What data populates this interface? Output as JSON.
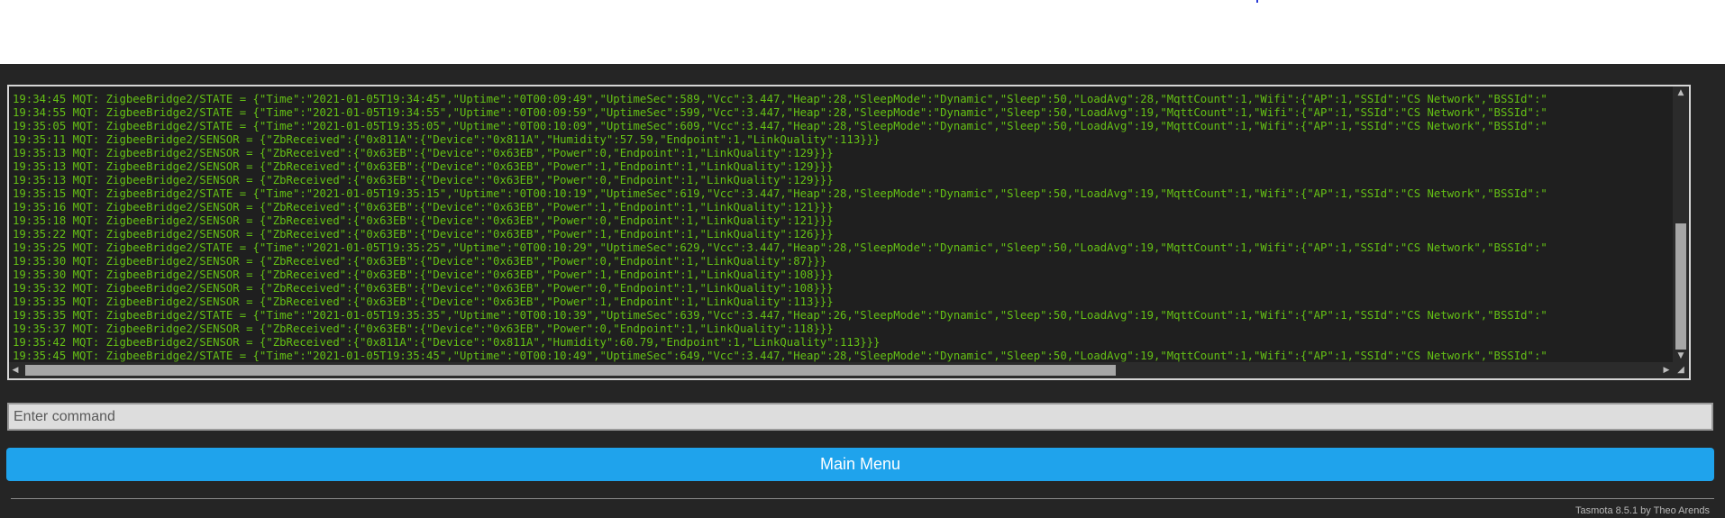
{
  "console": {
    "lines": [
      "19:34:45 MQT: ZigbeeBridge2/STATE = {\"Time\":\"2021-01-05T19:34:45\",\"Uptime\":\"0T00:09:49\",\"UptimeSec\":589,\"Vcc\":3.447,\"Heap\":28,\"SleepMode\":\"Dynamic\",\"Sleep\":50,\"LoadAvg\":28,\"MqttCount\":1,\"Wifi\":{\"AP\":1,\"SSId\":\"CS Network\",\"BSSId\":\"",
      "19:34:55 MQT: ZigbeeBridge2/STATE = {\"Time\":\"2021-01-05T19:34:55\",\"Uptime\":\"0T00:09:59\",\"UptimeSec\":599,\"Vcc\":3.447,\"Heap\":28,\"SleepMode\":\"Dynamic\",\"Sleep\":50,\"LoadAvg\":19,\"MqttCount\":1,\"Wifi\":{\"AP\":1,\"SSId\":\"CS Network\",\"BSSId\":\"",
      "19:35:05 MQT: ZigbeeBridge2/STATE = {\"Time\":\"2021-01-05T19:35:05\",\"Uptime\":\"0T00:10:09\",\"UptimeSec\":609,\"Vcc\":3.447,\"Heap\":28,\"SleepMode\":\"Dynamic\",\"Sleep\":50,\"LoadAvg\":19,\"MqttCount\":1,\"Wifi\":{\"AP\":1,\"SSId\":\"CS Network\",\"BSSId\":\"",
      "19:35:11 MQT: ZigbeeBridge2/SENSOR = {\"ZbReceived\":{\"0x811A\":{\"Device\":\"0x811A\",\"Humidity\":57.59,\"Endpoint\":1,\"LinkQuality\":113}}}",
      "19:35:13 MQT: ZigbeeBridge2/SENSOR = {\"ZbReceived\":{\"0x63EB\":{\"Device\":\"0x63EB\",\"Power\":0,\"Endpoint\":1,\"LinkQuality\":129}}}",
      "19:35:13 MQT: ZigbeeBridge2/SENSOR = {\"ZbReceived\":{\"0x63EB\":{\"Device\":\"0x63EB\",\"Power\":1,\"Endpoint\":1,\"LinkQuality\":129}}}",
      "19:35:13 MQT: ZigbeeBridge2/SENSOR = {\"ZbReceived\":{\"0x63EB\":{\"Device\":\"0x63EB\",\"Power\":0,\"Endpoint\":1,\"LinkQuality\":129}}}",
      "19:35:15 MQT: ZigbeeBridge2/STATE = {\"Time\":\"2021-01-05T19:35:15\",\"Uptime\":\"0T00:10:19\",\"UptimeSec\":619,\"Vcc\":3.447,\"Heap\":28,\"SleepMode\":\"Dynamic\",\"Sleep\":50,\"LoadAvg\":19,\"MqttCount\":1,\"Wifi\":{\"AP\":1,\"SSId\":\"CS Network\",\"BSSId\":\"",
      "19:35:16 MQT: ZigbeeBridge2/SENSOR = {\"ZbReceived\":{\"0x63EB\":{\"Device\":\"0x63EB\",\"Power\":1,\"Endpoint\":1,\"LinkQuality\":121}}}",
      "19:35:18 MQT: ZigbeeBridge2/SENSOR = {\"ZbReceived\":{\"0x63EB\":{\"Device\":\"0x63EB\",\"Power\":0,\"Endpoint\":1,\"LinkQuality\":121}}}",
      "19:35:22 MQT: ZigbeeBridge2/SENSOR = {\"ZbReceived\":{\"0x63EB\":{\"Device\":\"0x63EB\",\"Power\":1,\"Endpoint\":1,\"LinkQuality\":126}}}",
      "19:35:25 MQT: ZigbeeBridge2/STATE = {\"Time\":\"2021-01-05T19:35:25\",\"Uptime\":\"0T00:10:29\",\"UptimeSec\":629,\"Vcc\":3.447,\"Heap\":28,\"SleepMode\":\"Dynamic\",\"Sleep\":50,\"LoadAvg\":19,\"MqttCount\":1,\"Wifi\":{\"AP\":1,\"SSId\":\"CS Network\",\"BSSId\":\"",
      "19:35:30 MQT: ZigbeeBridge2/SENSOR = {\"ZbReceived\":{\"0x63EB\":{\"Device\":\"0x63EB\",\"Power\":0,\"Endpoint\":1,\"LinkQuality\":87}}}",
      "19:35:30 MQT: ZigbeeBridge2/SENSOR = {\"ZbReceived\":{\"0x63EB\":{\"Device\":\"0x63EB\",\"Power\":1,\"Endpoint\":1,\"LinkQuality\":108}}}",
      "19:35:32 MQT: ZigbeeBridge2/SENSOR = {\"ZbReceived\":{\"0x63EB\":{\"Device\":\"0x63EB\",\"Power\":0,\"Endpoint\":1,\"LinkQuality\":108}}}",
      "19:35:35 MQT: ZigbeeBridge2/SENSOR = {\"ZbReceived\":{\"0x63EB\":{\"Device\":\"0x63EB\",\"Power\":1,\"Endpoint\":1,\"LinkQuality\":113}}}",
      "19:35:35 MQT: ZigbeeBridge2/STATE = {\"Time\":\"2021-01-05T19:35:35\",\"Uptime\":\"0T00:10:39\",\"UptimeSec\":639,\"Vcc\":3.447,\"Heap\":26,\"SleepMode\":\"Dynamic\",\"Sleep\":50,\"LoadAvg\":19,\"MqttCount\":1,\"Wifi\":{\"AP\":1,\"SSId\":\"CS Network\",\"BSSId\":\"",
      "19:35:37 MQT: ZigbeeBridge2/SENSOR = {\"ZbReceived\":{\"0x63EB\":{\"Device\":\"0x63EB\",\"Power\":0,\"Endpoint\":1,\"LinkQuality\":118}}}",
      "19:35:42 MQT: ZigbeeBridge2/SENSOR = {\"ZbReceived\":{\"0x811A\":{\"Device\":\"0x811A\",\"Humidity\":60.79,\"Endpoint\":1,\"LinkQuality\":113}}}",
      "19:35:45 MQT: ZigbeeBridge2/STATE = {\"Time\":\"2021-01-05T19:35:45\",\"Uptime\":\"0T00:10:49\",\"UptimeSec\":649,\"Vcc\":3.447,\"Heap\":28,\"SleepMode\":\"Dynamic\",\"Sleep\":50,\"LoadAvg\":19,\"MqttCount\":1,\"Wifi\":{\"AP\":1,\"SSId\":\"CS Network\",\"BSSId\":\""
    ],
    "text_color": "#65c115",
    "background_color": "#1f1f1f"
  },
  "command": {
    "placeholder": "Enter command",
    "value": ""
  },
  "main_menu": {
    "label": "Main Menu",
    "color": "#1fa3ec"
  },
  "footer": {
    "text": "Tasmota 8.5.1 by Theo Arends"
  },
  "icons": {
    "scroll_up": "triangle-up-icon",
    "scroll_down": "triangle-down-icon",
    "scroll_left": "triangle-left-icon",
    "scroll_right": "triangle-right-icon",
    "resize": "resize-grip-icon"
  }
}
